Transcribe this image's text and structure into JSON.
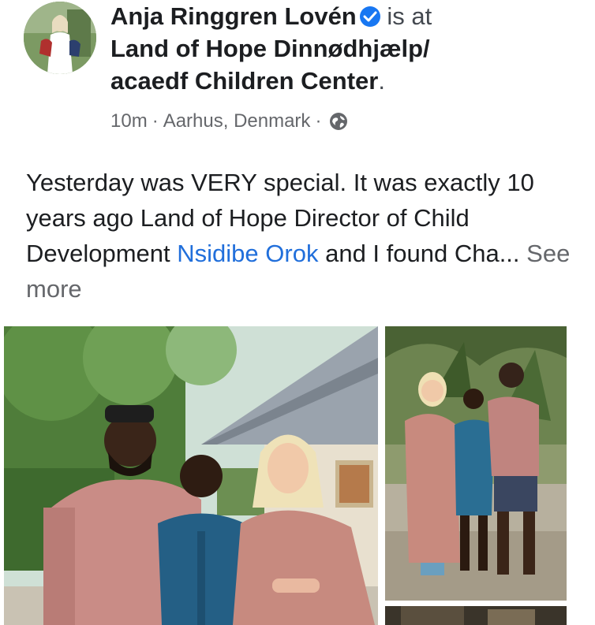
{
  "post": {
    "author": "Anja Ringgren Lovén",
    "status_text": "is at",
    "place_line1": "Land of Hope Dinnødhjælp/",
    "place_line2": "acaedf Children Center",
    "place_end": ".",
    "time": "10m",
    "separator": "·",
    "location": "Aarhus, Denmark",
    "privacy_icon": "globe-icon",
    "verified_icon": "verified-badge-icon",
    "text_part1": "Yesterday was VERY special. It was exactly 10 years ago Land of Hope Director of Child Development ",
    "mention": "Nsidibe Orok",
    "text_part2": " and I found Cha... ",
    "see_more": "See more"
  },
  "colors": {
    "link": "#216fdb",
    "secondary_text": "#65676b",
    "verified": "#1877f2"
  }
}
